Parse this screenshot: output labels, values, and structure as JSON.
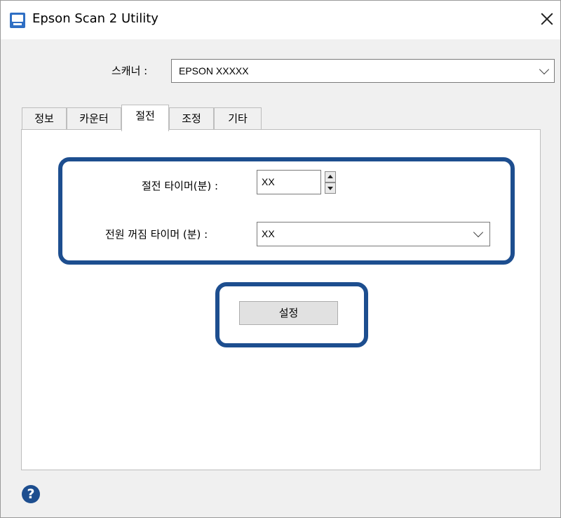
{
  "window": {
    "title": "Epson Scan 2 Utility"
  },
  "scanner": {
    "label": "스캐너 :",
    "value": "EPSON XXXXX"
  },
  "tabs": [
    {
      "label": "정보"
    },
    {
      "label": "카운터"
    },
    {
      "label": "절전",
      "active": true
    },
    {
      "label": "조정"
    },
    {
      "label": "기타"
    }
  ],
  "power_saving": {
    "sleep_timer_label": "절전 타이머(분) :",
    "sleep_timer_value": "XX",
    "power_off_timer_label": "전원 꺼짐 타이머 (분) :",
    "power_off_timer_value": "XX"
  },
  "actions": {
    "set_label": "설정"
  },
  "icons": {
    "app": "epson-scan-app-icon",
    "close": "close-icon",
    "help": "help-icon",
    "dropdown": "chevron-down-icon"
  },
  "colors": {
    "highlight": "#1d4e8f",
    "panel_bg": "#ffffff",
    "window_bg": "#f0f0f0"
  }
}
